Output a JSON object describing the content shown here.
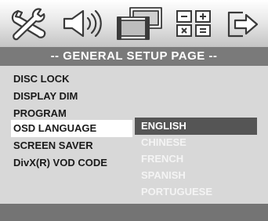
{
  "icons": [
    {
      "name": "general-setup-icon",
      "symbol": "tools-icon"
    },
    {
      "name": "audio-setup-icon",
      "symbol": "speaker-icon"
    },
    {
      "name": "video-setup-icon",
      "symbol": "film-icon"
    },
    {
      "name": "preference-setup-icon",
      "symbol": "grid-icon"
    },
    {
      "name": "exit-setup-icon",
      "symbol": "exit-arrow-icon"
    }
  ],
  "title": "-- GENERAL SETUP PAGE --",
  "menu": {
    "items": [
      {
        "label": "DISC LOCK"
      },
      {
        "label": "DISPLAY DIM"
      },
      {
        "label": "PROGRAM"
      },
      {
        "label": "OSD LANGUAGE"
      },
      {
        "label": "SCREEN SAVER"
      },
      {
        "label": "DivX(R) VOD CODE"
      }
    ],
    "selected": "OSD LANGUAGE"
  },
  "options": {
    "items": [
      {
        "label": "ENGLISH"
      },
      {
        "label": "CHINESE"
      },
      {
        "label": "FRENCH"
      },
      {
        "label": "SPANISH"
      },
      {
        "label": "PORTUGUESE"
      }
    ],
    "selected": "ENGLISH"
  },
  "colors": {
    "panel": "#d8d8d8",
    "title_bar": "#7a7a7a",
    "highlight_menu": "#ffffff",
    "highlight_option": "#555555",
    "option_text": "#f4f4f4"
  }
}
